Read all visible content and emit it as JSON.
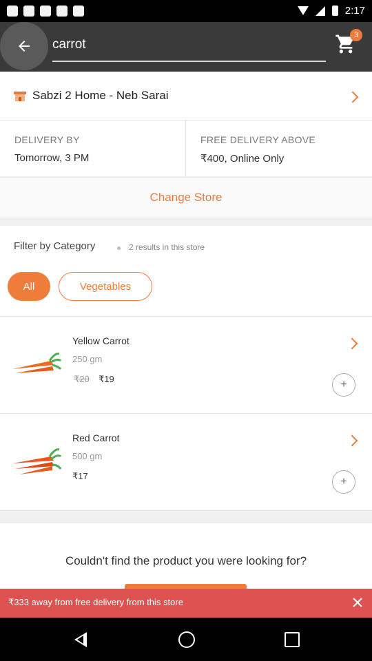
{
  "status_bar": {
    "time": "2:17"
  },
  "search": {
    "query": "carrot",
    "cart_count": "3"
  },
  "store": {
    "name": "Sabzi 2 Home - Neb Sarai"
  },
  "delivery": {
    "left_label": "DELIVERY BY",
    "left_value": "Tomorrow, 3 PM",
    "right_label": "FREE DELIVERY ABOVE",
    "right_value": "₹400, Online Only"
  },
  "change_store_label": "Change Store",
  "filter": {
    "title": "Filter by Category",
    "results": "2 results in this store",
    "chips": [
      "All",
      "Vegetables"
    ]
  },
  "products": [
    {
      "name": "Yellow Carrot",
      "size": "250 gm",
      "old_price": "₹20",
      "price": "₹19"
    },
    {
      "name": "Red Carrot",
      "size": "500 gm",
      "old_price": "",
      "price": "₹17"
    }
  ],
  "not_found": {
    "text": "Couldn't find the product you were looking for?"
  },
  "banner": {
    "text": "₹333 away from free delivery from this store"
  },
  "colors": {
    "accent": "#f07c3c",
    "banner": "#dd5151",
    "topbar": "#3a3a3a"
  }
}
